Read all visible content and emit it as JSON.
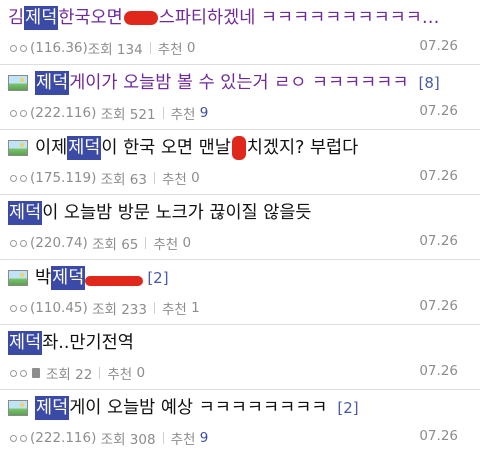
{
  "posts": [
    {
      "title_parts": [
        "김",
        "제덕",
        " 한국오면",
        "",
        "스파티하겠네 ㅋㅋㅋㅋㅋㅋㅋㅋㅋㅋ…"
      ],
      "visited": true,
      "comment_count": "",
      "ip": "(116.36)",
      "views": "조회 134",
      "rec_label": "추천",
      "rec_value": "0",
      "date": "07.26"
    },
    {
      "title_parts": [
        "",
        "제덕",
        " 게이가 오늘밤 볼 수 있는거 ㄹㅇ ㅋㅋㅋㅋㅋㅋ",
        "",
        ""
      ],
      "visited": true,
      "comment_count": "[8]",
      "ip": "(222.116)",
      "views": "조회 521",
      "rec_label": "추천",
      "rec_value": "9",
      "date": "07.26"
    },
    {
      "title_parts": [
        "이제 ",
        "제덕",
        "이 한국 오면 맨날",
        "",
        "치겠지? 부럽다"
      ],
      "visited": false,
      "comment_count": "",
      "ip": "(175.119)",
      "views": "조회 63",
      "rec_label": "추천",
      "rec_value": "0",
      "date": "07.26"
    },
    {
      "title_parts": [
        "",
        "제덕",
        "이 오늘밤 방문 노크가 끊이질 않을듯",
        "",
        ""
      ],
      "visited": false,
      "comment_count": "",
      "ip": "(220.74)",
      "views": "조회 65",
      "rec_label": "추천",
      "rec_value": "0",
      "date": "07.26"
    },
    {
      "title_parts": [
        "박",
        "제덕",
        " ",
        "",
        ""
      ],
      "visited": false,
      "comment_count": "[2]",
      "ip": "(110.45)",
      "views": "조회 233",
      "rec_label": "추천",
      "rec_value": "1",
      "date": "07.26"
    },
    {
      "title_parts": [
        "",
        "제덕",
        "좌..만기전역",
        "",
        ""
      ],
      "visited": false,
      "comment_count": "",
      "ip": "",
      "views": "조회 22",
      "rec_label": "추천",
      "rec_value": "0",
      "date": "07.26"
    },
    {
      "title_parts": [
        "",
        "제덕",
        " 게이 오늘밤 예상 ㅋㅋㅋㅋㅋㅋㅋㅋ",
        "",
        ""
      ],
      "visited": false,
      "comment_count": "[2]",
      "ip": "(222.116)",
      "views": "조회 308",
      "rec_label": "추천",
      "rec_value": "9",
      "date": "07.26"
    }
  ]
}
